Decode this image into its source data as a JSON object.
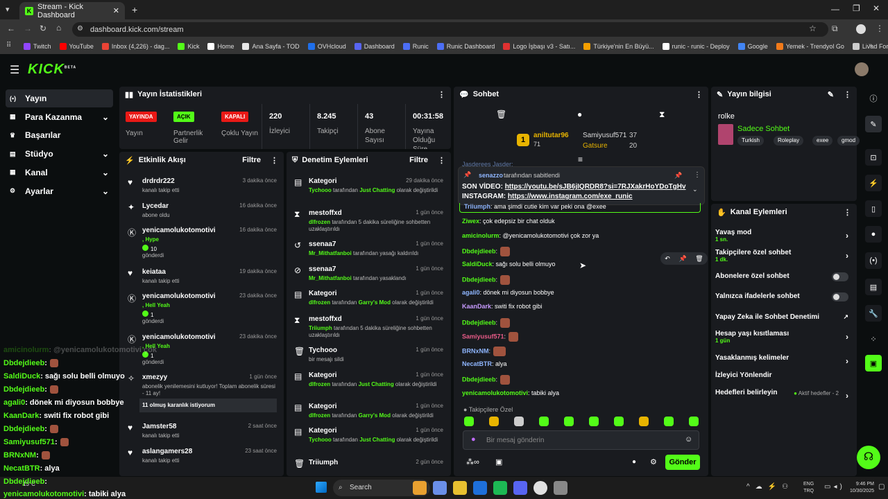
{
  "browser": {
    "tab_title": "Stream - Kick Dashboard",
    "url": "dashboard.kick.com/stream",
    "bookmarks": [
      {
        "label": "Twitch",
        "color": "#9146ff"
      },
      {
        "label": "YouTube",
        "color": "#ff0000"
      },
      {
        "label": "Inbox (4,226) - dag...",
        "color": "#ea4335"
      },
      {
        "label": "Kick",
        "color": "#53fc18"
      },
      {
        "label": "Home",
        "color": "#ffffff"
      },
      {
        "label": "Ana Sayfa - TOD",
        "color": "#e8e8e8"
      },
      {
        "label": "OVHcloud",
        "color": "#1f6feb"
      },
      {
        "label": "Dashboard",
        "color": "#5865f2"
      },
      {
        "label": "Runic",
        "color": "#4c6ef5"
      },
      {
        "label": "Runic Dashboard",
        "color": "#4c6ef5"
      },
      {
        "label": "Logo İşbaşı v3 - Satı...",
        "color": "#e03131"
      },
      {
        "label": "Türkiye'nin En Büyü...",
        "color": "#f59f00"
      },
      {
        "label": "runic - runic - Deploy",
        "color": "#ffffff"
      },
      {
        "label": "Google",
        "color": "#4285f4"
      },
      {
        "label": "Yemek - Trendyol Go",
        "color": "#f27a1a"
      },
      {
        "label": "Livad For Streamers",
        "color": "#cccccc"
      }
    ]
  },
  "nav": {
    "logo": "KICK",
    "logo_sup": "BETA",
    "items": [
      {
        "label": "Yayın",
        "icon": "broadcast-icon"
      },
      {
        "label": "Para Kazanma",
        "icon": "money-icon"
      },
      {
        "label": "Başarılar",
        "icon": "trophy-icon"
      },
      {
        "label": "Stüdyo",
        "icon": "studio-icon"
      },
      {
        "label": "Kanal",
        "icon": "channel-icon"
      },
      {
        "label": "Ayarlar",
        "icon": "gear-icon"
      }
    ]
  },
  "stats": {
    "title": "Yayın İstatistikleri",
    "badges": [
      {
        "text": "YAYINDA",
        "label": "Yayın",
        "color": "#e91916"
      },
      {
        "text": "AÇIK",
        "label": "Partnerlik Gelir",
        "color": "#53fc18"
      },
      {
        "text": "KAPALI",
        "label": "Çoklu Yayın",
        "color": "#e91916"
      }
    ],
    "numbers": [
      {
        "value": "220",
        "label": "İzleyici"
      },
      {
        "value": "8.245",
        "label": "Takipçi"
      },
      {
        "value": "43",
        "label": "Abone Sayısı"
      },
      {
        "value": "00:31:58",
        "label": "Yayına Olduğu Süre"
      }
    ]
  },
  "activity": {
    "title": "Etkinlik Akışı",
    "filter": "Filtre",
    "items": [
      {
        "name": "drdrdr222",
        "sub": "kanalı takip etti",
        "time": "3 dakika önce",
        "icon": "heart-icon"
      },
      {
        "name": "Lycedar",
        "sub": "abone oldu",
        "time": "16 dakika önce",
        "icon": "star-icon"
      },
      {
        "name": "yenicamolukotomotivi",
        "sub": ", Hype",
        "extra": "10",
        "extra2": "gönderdi",
        "time": "16 dakika önce",
        "icon": "kick-icon"
      },
      {
        "name": "keiataa",
        "sub": "kanalı takip etti",
        "time": "19 dakika önce",
        "icon": "heart-icon"
      },
      {
        "name": "yenicamolukotomotivi",
        "sub": ", Hell Yeah",
        "extra": "1",
        "extra2": "gönderdi",
        "time": "23 dakika önce",
        "icon": "kick-icon"
      },
      {
        "name": "yenicamolukotomotivi",
        "sub": ", Hell Yeah",
        "extra": "1",
        "extra2": "gönderdi",
        "time": "23 dakika önce",
        "icon": "kick-icon"
      },
      {
        "name": "xmezyy",
        "sub": "abonelik yenilemesini kutluyor! Toplam abonelik süresi - 11 ay!",
        "msg": "11 olmuş karanlık istiyorum",
        "time": "1 gün önce",
        "icon": "sparkle-icon"
      },
      {
        "name": "Jamster58",
        "sub": "kanalı takip etti",
        "time": "2 saat önce",
        "icon": "heart-icon"
      },
      {
        "name": "aslangamers28",
        "sub": "kanalı takip etti",
        "time": "23 saat önce",
        "icon": "heart-icon"
      }
    ]
  },
  "moderation": {
    "title": "Denetim Eylemleri",
    "filter": "Filtre",
    "items": [
      {
        "name": "Kategori",
        "time": "29 dakika önce",
        "actor": "Tychooo",
        "text": " tarafından ",
        "target": "Just Chatting",
        "rest": " olarak değiştirildi",
        "icon": "category-icon"
      },
      {
        "name": "mestoffxd",
        "time": "1 gün önce",
        "actor": "dlfrozen",
        "text": " tarafından 5 dakika süreliğine sohbetten uzaklaştırıldı",
        "icon": "hourglass-icon"
      },
      {
        "name": "ssenaa7",
        "time": "1 gün önce",
        "actor": "Mr_Mithatfanboi",
        "text": " tarafından yasağı kaldırıldı",
        "icon": "unban-icon"
      },
      {
        "name": "ssenaa7",
        "time": "1 gün önce",
        "actor": "Mr_Mithatfanboi",
        "text": " tarafından yasaklandı",
        "icon": "ban-icon"
      },
      {
        "name": "Kategori",
        "time": "1 gün önce",
        "actor": "dlfrozen",
        "text": " tarafından ",
        "target": "Garry's Mod",
        "rest": " olarak değiştirildi",
        "icon": "category-icon"
      },
      {
        "name": "mestoffxd",
        "time": "1 gün önce",
        "actor": "Triiumph",
        "text": " tarafından 5 dakika süreliğine sohbetten uzaklaştırıldı",
        "icon": "hourglass-icon"
      },
      {
        "name": "Tychooo",
        "time": "1 gün önce",
        "text": "bir mesajı sildi",
        "icon": "trash-icon"
      },
      {
        "name": "Kategori",
        "time": "1 gün önce",
        "actor": "dlfrozen",
        "text": " tarafından ",
        "target": "Just Chatting",
        "rest": " olarak değiştirildi",
        "icon": "category-icon"
      },
      {
        "name": "Kategori",
        "time": "1 gün önce",
        "actor": "dlfrozen",
        "text": " tarafından ",
        "target": "Garry's Mod",
        "rest": " olarak değiştirildi",
        "icon": "category-icon"
      },
      {
        "name": "Kategori",
        "time": "1 gün önce",
        "actor": "Tychooo",
        "text": " tarafından ",
        "target": "Just Chatting",
        "rest": " olarak değiştirildi",
        "icon": "category-icon"
      },
      {
        "name": "Triiumph",
        "time": "2 gün önce",
        "icon": "trash-icon"
      }
    ]
  },
  "chat": {
    "title": "Sohbet",
    "leader1": {
      "rank": "1",
      "name": "aniltutar96",
      "count": "71"
    },
    "leader2": {
      "name": "Samiyusuf571",
      "count": "37"
    },
    "leader3": {
      "name": "Gatsure",
      "count": "20"
    },
    "pinned": {
      "by": "senazzo",
      "note": "tarafından sabitlendi",
      "line1_label": "SON VİDEO:",
      "line1_link": "https://youtu.be/sJB6jIQRDR8?si=7RJXakrHoYDoTgHv",
      "line2_label": "INSTAGRAM:",
      "line2_link": "https://www.instagram.com/exe_runic"
    },
    "partial_top": "Jasderees Jasder:",
    "partial2_user": "Triiumph",
    "partial2_text": ": ama şimdi cutie kim var peki ona @exee",
    "lines": [
      {
        "user": "Ziwex",
        "color": "#53fc18",
        "text": ": çok edepsiz bir chat olduk"
      },
      {
        "user": "amicinolurm",
        "color": "#53fc18",
        "text": ": @yenicamolukotomotivi çok zor ya"
      },
      {
        "user": "Dbdejdieeb",
        "color": "#53fc18",
        "text": ":",
        "emote": true
      },
      {
        "user": "SaldiDuck",
        "color": "#53fc18",
        "text": ": sağı solu belli olmuyo"
      },
      {
        "user": "Dbdejdieeb",
        "color": "#53fc18",
        "text": ":",
        "emote": true
      },
      {
        "user": "agali0",
        "color": "#8fb6ff",
        "text": ": dönek mi diyosun bobbye"
      },
      {
        "user": "KaanDark",
        "color": "#c79bff",
        "text": ": switi fix robot gibi"
      },
      {
        "user": "Dbdejdieeb",
        "color": "#53fc18",
        "text": ":",
        "emote": true
      },
      {
        "user": "Samiyusuf571",
        "color": "#e95b88",
        "text": ":",
        "emote": true
      },
      {
        "user": "BRNxNM",
        "color": "#8fb6ff",
        "text": ":",
        "emote": true
      },
      {
        "user": "NecatBTR",
        "color": "#8fb6ff",
        "text": ": alya"
      },
      {
        "user": "Dbdejdieeb",
        "color": "#53fc18",
        "text": ":",
        "emote": true
      },
      {
        "user": "yenicamolukotomotivi",
        "color": "#53fc18",
        "text": ": tabiki alya"
      }
    ],
    "followers_label": "Takipçilere Özel",
    "placeholder": "Bir mesaj gönderin",
    "send": "Gönder"
  },
  "stream_info": {
    "title": "Yayın bilgisi",
    "stream_title": "rolke",
    "category": "Sadece Sohbet",
    "tags": [
      "Turkish",
      "Roleplay",
      "exee",
      "gmod"
    ]
  },
  "channel_actions": {
    "title": "Kanal Eylemleri",
    "items": [
      {
        "label": "Yavaş mod",
        "sub": "1 sn.",
        "type": "arrow"
      },
      {
        "label": "Takipçilere özel sohbet",
        "sub": "1 dk.",
        "type": "arrow"
      },
      {
        "label": "Abonelere özel sohbet",
        "type": "toggle"
      },
      {
        "label": "Yalnızca ifadelerle sohbet",
        "type": "toggle"
      },
      {
        "label": "Yapay Zeka ile Sohbet Denetimi",
        "type": "external"
      },
      {
        "label": "Hesap yaşı kısıtlaması",
        "sub": "1 gün",
        "type": "arrow"
      },
      {
        "label": "Yasaklanmış kelimeler",
        "type": "arrow"
      },
      {
        "label": "İzleyici Yönlendir",
        "type": "none"
      },
      {
        "label": "Hedefleri belirleyin",
        "status": "Aktif hedefler - 2",
        "type": "arrow"
      }
    ]
  },
  "overlay_chat": [
    {
      "user": "amicinolurm",
      "text": ": @yenicamolukotomotivi çok",
      "faded": true
    },
    {
      "user": "Dbdejdieeb",
      "text": ":",
      "emote": true
    },
    {
      "user": "SaldiDuck",
      "text": ": sağı solu belli olmuyo"
    },
    {
      "user": "Dbdejdieeb",
      "text": ":",
      "emote": true
    },
    {
      "user": "agali0",
      "text": ": dönek mi diyosun bobbye"
    },
    {
      "user": "KaanDark",
      "text": ": switi fix robot gibi"
    },
    {
      "user": "Dbdejdieeb",
      "text": ":",
      "emote": true
    },
    {
      "user": "Samiyusuf571",
      "text": ":",
      "emote": true
    },
    {
      "user": "BRNxNM",
      "text": ":",
      "emote": true
    },
    {
      "user": "NecatBTR",
      "text": ": alya"
    },
    {
      "user": "Dbdejdieeb",
      "text": ":"
    },
    {
      "user": "yenicamolukotomotivi",
      "text": ": tabiki alya"
    }
  ],
  "taskbar": {
    "weather": "13°C",
    "search": "Search",
    "lang1": "ENG",
    "lang2": "TRQ",
    "time": "9:46 PM",
    "date": "10/30/2025"
  }
}
